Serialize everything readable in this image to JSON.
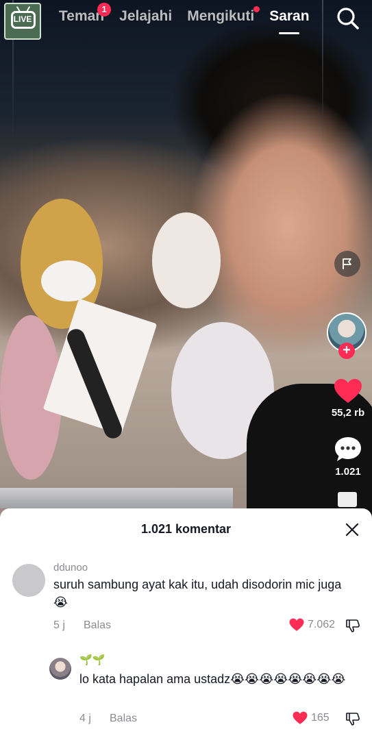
{
  "topbar": {
    "live_label": "LIVE",
    "tabs": [
      {
        "label": "Teman",
        "badge": "1"
      },
      {
        "label": "Jelajahi"
      },
      {
        "label": "Mengikuti",
        "dot": true
      },
      {
        "label": "Saran",
        "active": true
      }
    ]
  },
  "rail": {
    "likes": "55,2 rb",
    "comments": "1.021"
  },
  "sheet": {
    "title": "1.021 komentar",
    "comments": [
      {
        "user": "ddunoo",
        "text": "suruh sambung ayat kak itu, udah disodorin mic juga😭",
        "time": "5 j",
        "reply": "Balas",
        "likes": "7.062"
      },
      {
        "user": "🌱🌱",
        "text": "lo kata hapalan ama ustadz😭😭😭😭😭😭😭😭",
        "time": "4 j",
        "reply": "Balas",
        "likes": "165"
      }
    ]
  },
  "colors": {
    "accent": "#fe2c55",
    "sheet_bg": "#ffffff",
    "muted_text": "#8a8b91"
  }
}
